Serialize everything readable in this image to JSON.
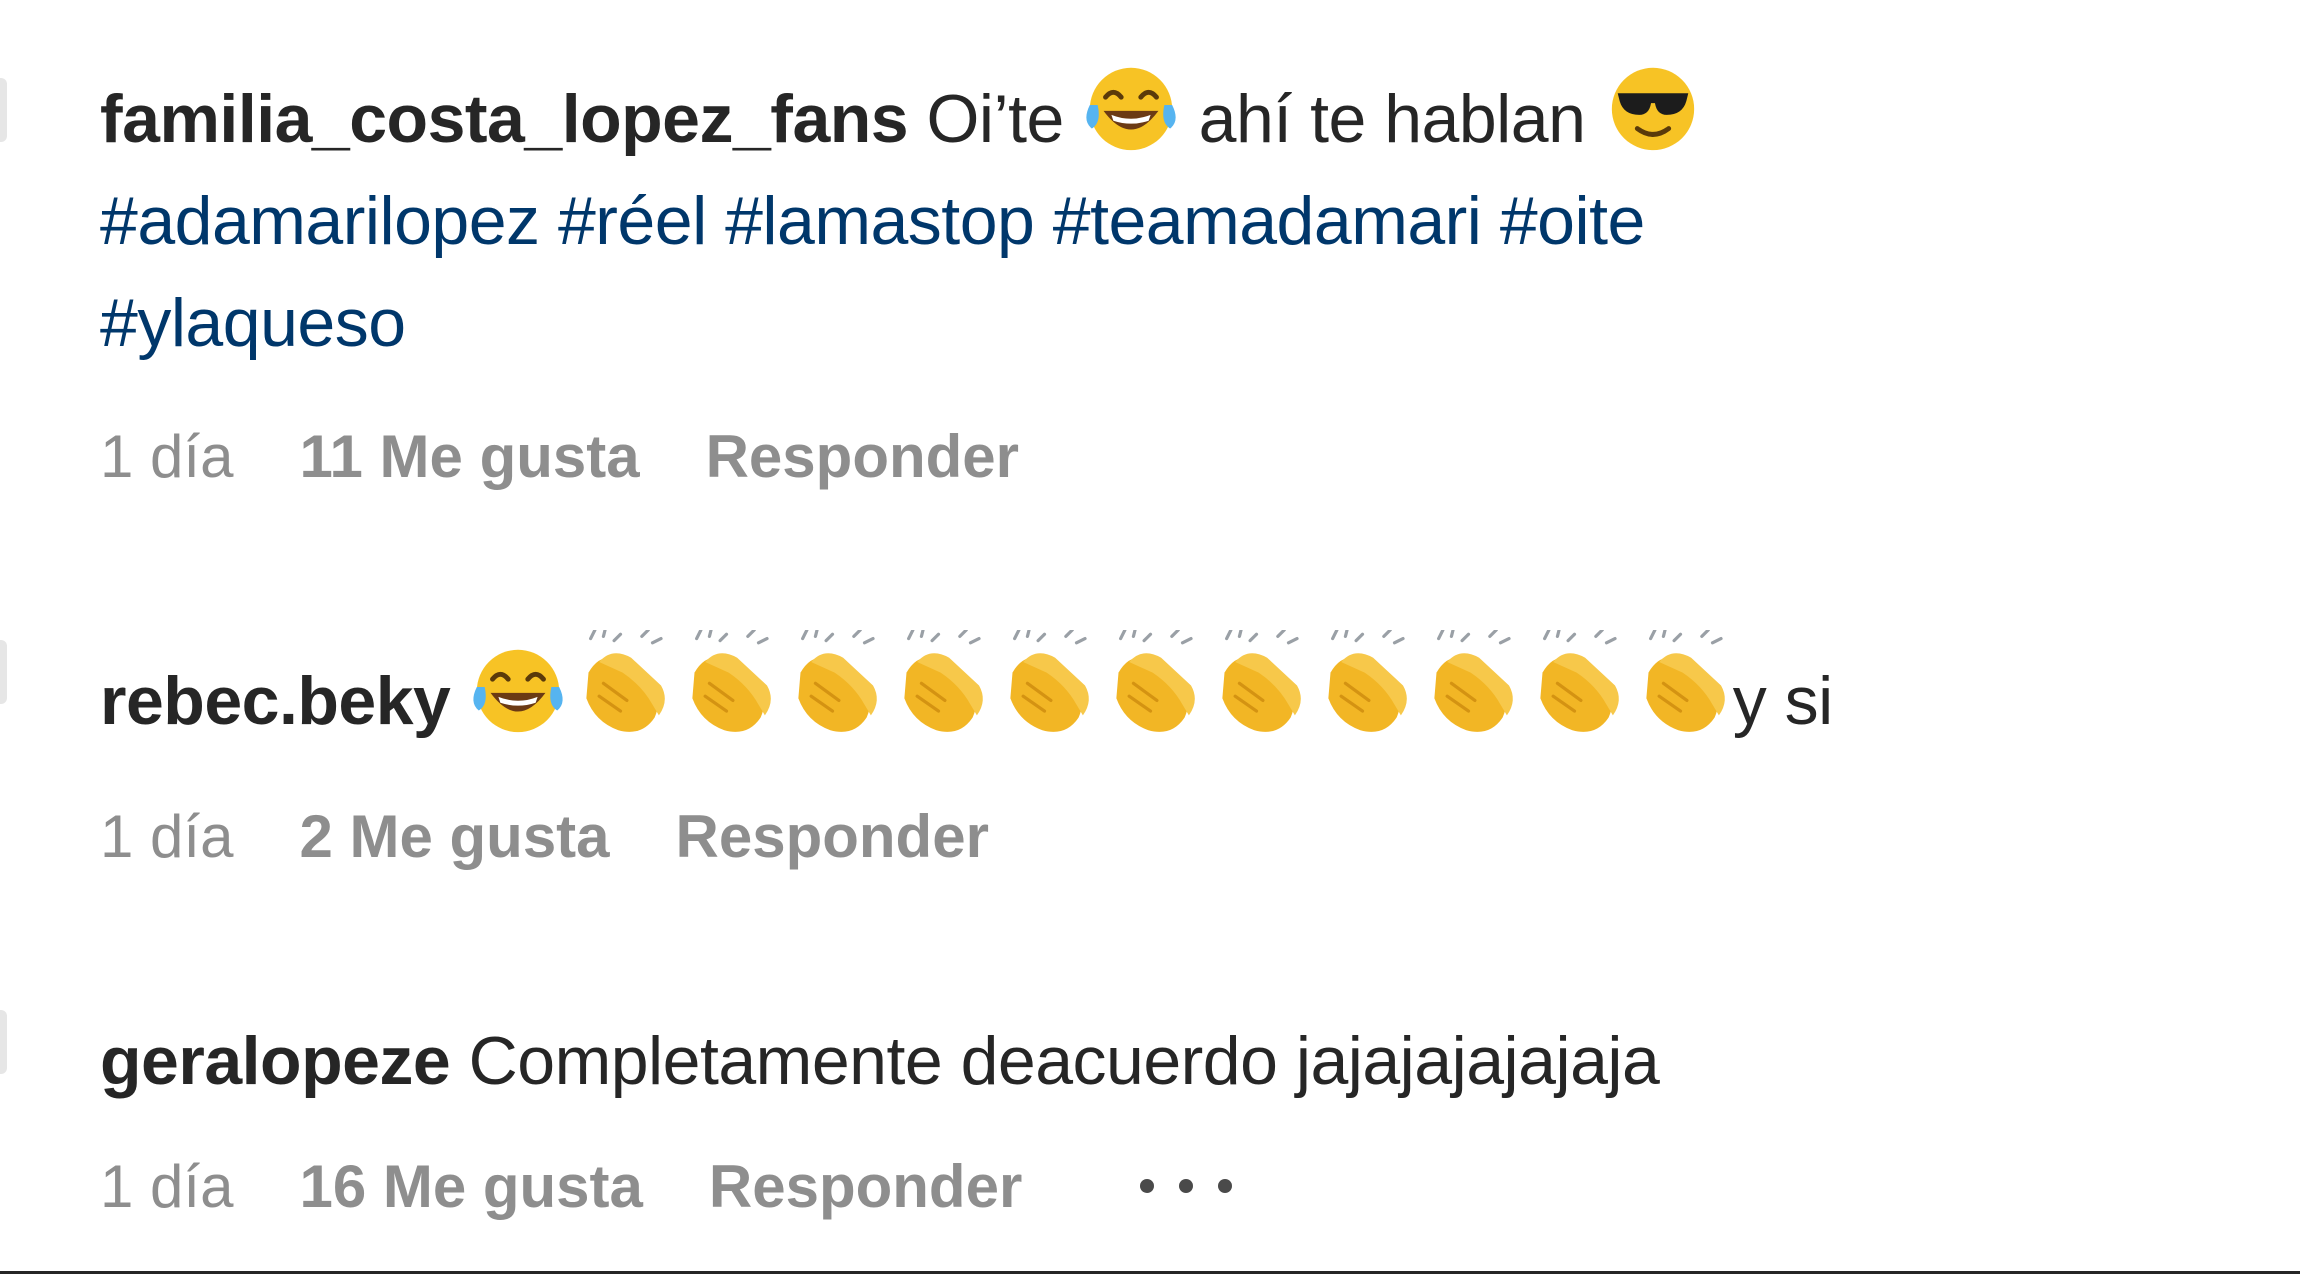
{
  "comments": [
    {
      "username": "familia_costa_lopez_fans",
      "text_1": "Oi’te",
      "emoji_1": "face-with-tears-of-joy",
      "text_2": "ahí te hablan",
      "emoji_2": "smiling-face-with-sunglasses",
      "hashtags": [
        "#adamarilopez",
        "#réel",
        "#lamastop",
        "#teamadamari",
        "#oite",
        "#ylaqueso"
      ],
      "time": "1 día",
      "likes": "11 Me gusta",
      "reply": "Responder"
    },
    {
      "username": "rebec.beky",
      "emoji_1": "face-with-tears-of-joy",
      "clap_count": 11,
      "clap_emoji": "clapping-hands",
      "text": "y si",
      "time": "1 día",
      "likes": "2 Me gusta",
      "reply": "Responder"
    },
    {
      "username": "geralopeze",
      "text": "Completamente deacuerdo jajajajajajaja",
      "time": "1 día",
      "likes": "16 Me gusta",
      "reply": "Responder",
      "more_icon": "more-options-icon"
    }
  ],
  "colors": {
    "text": "#262626",
    "hashtag": "#00376b",
    "meta": "#8e8e8e",
    "emoji_yellow": "#f7c325"
  }
}
